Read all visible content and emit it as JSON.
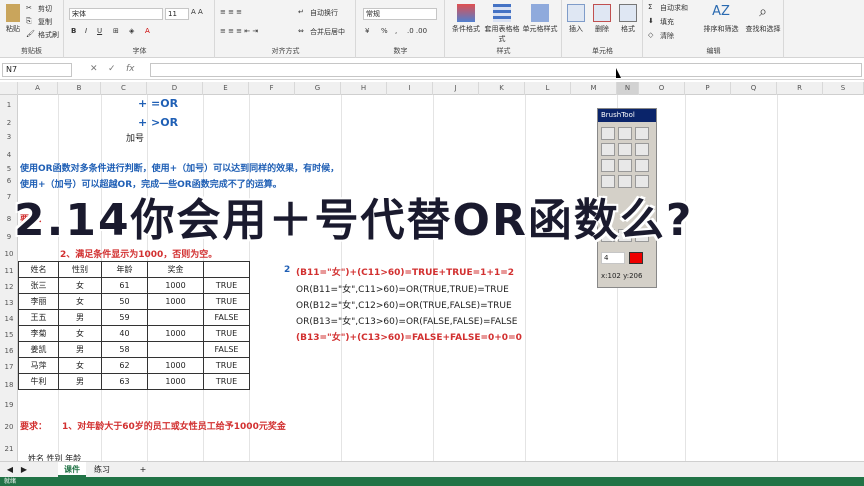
{
  "ribbon": {
    "clipboard": {
      "paste": "粘贴",
      "cut": "剪切",
      "copy": "复制",
      "format_painter": "格式刷",
      "group": "剪贴板"
    },
    "font": {
      "name": "宋体",
      "size": "11",
      "group": "字体",
      "bold": "B",
      "italic": "I",
      "underline": "U"
    },
    "alignment": {
      "wrap": "自动换行",
      "merge": "合并后居中",
      "group": "对齐方式"
    },
    "number": {
      "format": "常规",
      "percent": "%",
      "comma": ",",
      "group": "数字"
    },
    "styles": {
      "conditional": "条件格式",
      "table": "套用表格格式",
      "cell_styles": "单元格样式",
      "group": "样式"
    },
    "cells": {
      "insert": "插入",
      "delete": "删除",
      "format": "格式",
      "group": "单元格"
    },
    "editing": {
      "autosum": "自动求和",
      "fill": "填充",
      "clear": "清除",
      "sort": "排序和筛选",
      "find": "查找和选择",
      "group": "编辑"
    }
  },
  "formula_bar": {
    "name_box": "N7",
    "cancel": "✕",
    "enter": "✓",
    "fx": "fx",
    "content": ""
  },
  "columns": [
    "A",
    "B",
    "C",
    "D",
    "E",
    "F",
    "G",
    "H",
    "I",
    "J",
    "K",
    "L",
    "M",
    "N",
    "O",
    "P",
    "Q",
    "R",
    "S"
  ],
  "rows": [
    "1",
    "2",
    "3",
    "4",
    "5",
    "6",
    "7",
    "8",
    "9",
    "10",
    "11",
    "12",
    "13",
    "14",
    "15",
    "16",
    "17",
    "18",
    "19",
    "20",
    "21"
  ],
  "content": {
    "r1": "+ =OR",
    "r2": "+ >OR",
    "r3": "加号",
    "desc1": "使用OR函数对多条件进行判断，使用+（加号）可以达到同样的效果，有时候，",
    "desc2": "使用+（加号）可以超越OR，完成一些OR函数完成不了的运算。",
    "req_label": "要求：",
    "req2": "2、满足条件显示为1000，否则为空。",
    "req_bottom": "1、对年龄大于60岁的员工或女性员工给予1000元奖金",
    "f_num": "2",
    "f1": "(B11=\"女\")+(C11>60)=TRUE+TRUE=1+1=2",
    "f2": "OR(B11=\"女\",C11>60)=OR(TRUE,TRUE)=TRUE",
    "f3": "OR(B12=\"女\",C12>60)=OR(TRUE,FALSE)=TRUE",
    "f4": "OR(B13=\"女\",C13>60)=OR(FALSE,FALSE)=FALSE",
    "f5": "(B13=\"女\")+(C13>60)=FALSE+FALSE=0+0=0",
    "bottom_headers": "姓名    性别    年龄"
  },
  "table": {
    "headers": [
      "姓名",
      "性别",
      "年龄",
      "奖金",
      ""
    ],
    "rows": [
      [
        "张三",
        "女",
        "61",
        "1000",
        "TRUE"
      ],
      [
        "李丽",
        "女",
        "50",
        "1000",
        "TRUE"
      ],
      [
        "王五",
        "男",
        "59",
        "",
        "FALSE"
      ],
      [
        "李菊",
        "女",
        "40",
        "1000",
        "TRUE"
      ],
      [
        "姜凯",
        "男",
        "58",
        "",
        "FALSE"
      ],
      [
        "马萍",
        "女",
        "62",
        "1000",
        "TRUE"
      ],
      [
        "牛利",
        "男",
        "63",
        "1000",
        "TRUE"
      ]
    ]
  },
  "overlay_title": "2.14你会用＋号代替OR函数么?",
  "brush_tool": {
    "title": "BrushTool",
    "size": "4",
    "coords": "x:102  y:206"
  },
  "tabs": {
    "active": "课件",
    "other": "练习",
    "add": "+"
  },
  "status": "就绪",
  "colors": {
    "excel_green": "#217346",
    "blue_text": "#1f5fb5",
    "red_text": "#d23030"
  }
}
